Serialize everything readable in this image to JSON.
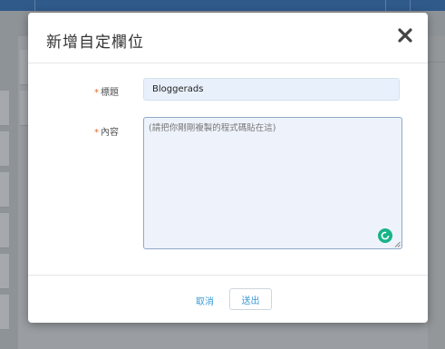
{
  "background": {
    "nav_left": "...",
    "nav_right": "..."
  },
  "modal": {
    "title": "新增自定欄位",
    "close_icon": "close-x-icon",
    "fields": {
      "title": {
        "required_mark": "*",
        "label": "標題",
        "value": "Bloggerads"
      },
      "content": {
        "required_mark": "*",
        "label": "內容",
        "placeholder": "(請把你剛剛複製的程式碼貼在這)"
      }
    },
    "footer": {
      "cancel_label": "取消",
      "submit_label": "送出"
    }
  },
  "colors": {
    "accent": "#3a9bd6",
    "required": "#e06a2e",
    "grammar_badge": "#19b38a"
  }
}
